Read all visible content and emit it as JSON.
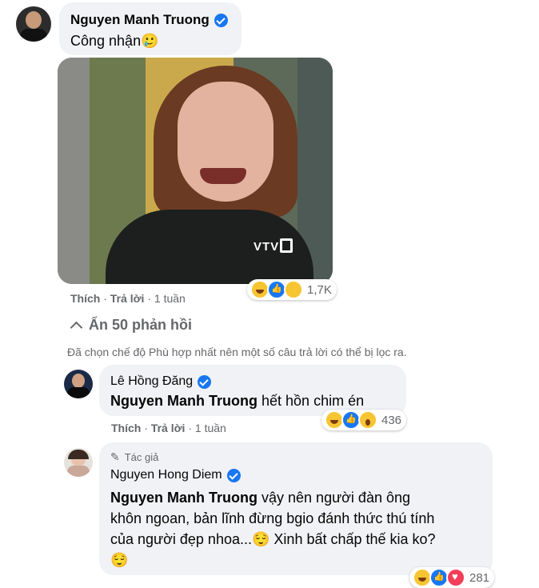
{
  "comment": {
    "author": "Nguyen Manh Truong",
    "text": "Công nhận",
    "emoji": "🥲",
    "like_label": "Thích",
    "reply_label": "Trả lời",
    "time": "1 tuần",
    "reaction_count": "1,7K",
    "image_watermark": "VTV"
  },
  "hide_replies": {
    "label": "Ẩn 50 phản hồi"
  },
  "filter_notice": "Đã chọn chế độ Phù hợp nhất nên một số câu trả lời có thể bị lọc ra.",
  "replies": [
    {
      "author": "Lê Hồng Đăng",
      "mention": "Nguyen Manh Truong",
      "text": "hết hồn chim én",
      "like_label": "Thích",
      "reply_label": "Trả lời",
      "time": "1 tuần",
      "reaction_count": "436"
    },
    {
      "badge": "Tác giả",
      "author": "Nguyen Hong Diem",
      "mention": "Nguyen Manh Truong",
      "text_line1": "vậy nên người đàn ông",
      "text_line2": "khôn ngoan, bản lĩnh đừng bgio đánh thức thú tính",
      "text_line3": "của người đẹp nhoa...",
      "text_line3b": "Xinh bất chấp thế kia ko?",
      "emoji": "😌",
      "reaction_count": "281"
    }
  ],
  "colors": {
    "accent": "#1877f2",
    "bubble": "#f0f2f5",
    "meta": "#65676b"
  }
}
